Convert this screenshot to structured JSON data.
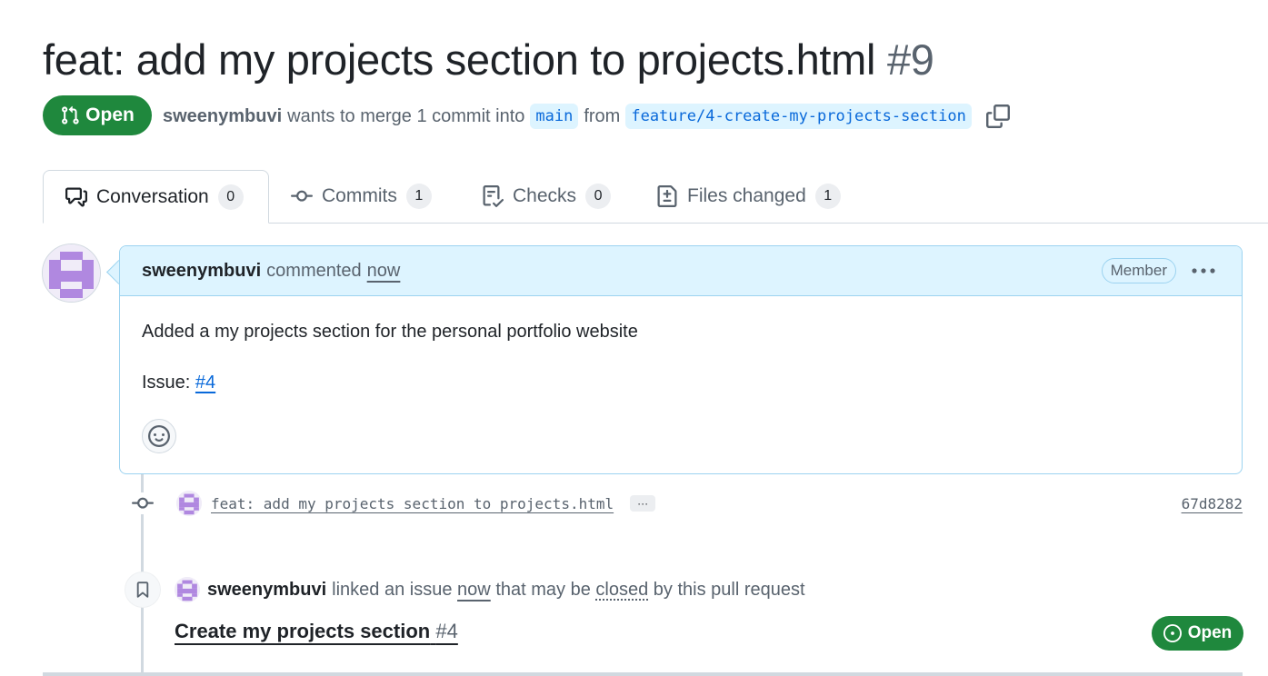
{
  "pr": {
    "title": "feat: add my projects section to projects.html",
    "number": "#9",
    "state": "Open",
    "author": "sweenymbuvi",
    "merge_text": "wants to merge 1 commit into",
    "base_branch": "main",
    "from_text": "from",
    "head_branch": "feature/4-create-my-projects-section"
  },
  "tabs": [
    {
      "label": "Conversation",
      "count": "0",
      "icon": "comment-discussion-icon"
    },
    {
      "label": "Commits",
      "count": "1",
      "icon": "git-commit-icon"
    },
    {
      "label": "Checks",
      "count": "0",
      "icon": "checklist-icon"
    },
    {
      "label": "Files changed",
      "count": "1",
      "icon": "file-diff-icon"
    }
  ],
  "comment": {
    "author": "sweenymbuvi",
    "action": "commented",
    "when": "now",
    "role": "Member",
    "body_line": "Added a my projects section for the personal portfolio website",
    "issue_label": "Issue:",
    "issue_ref": "#4"
  },
  "commit": {
    "message": "feat: add my projects section to projects.html",
    "ellipsis": "···",
    "sha": "67d8282"
  },
  "linked": {
    "author": "sweenymbuvi",
    "text1": "linked an issue",
    "when": "now",
    "text2": "that may be",
    "closed": "closed",
    "text3": "by this pull request",
    "issue_title": "Create my projects section",
    "issue_number": "#4",
    "issue_state": "Open"
  },
  "colors": {
    "open_green": "#1f883d",
    "link_blue": "#0969da",
    "header_blue": "#ddf4ff",
    "avatar_purple": "#b088e0"
  }
}
